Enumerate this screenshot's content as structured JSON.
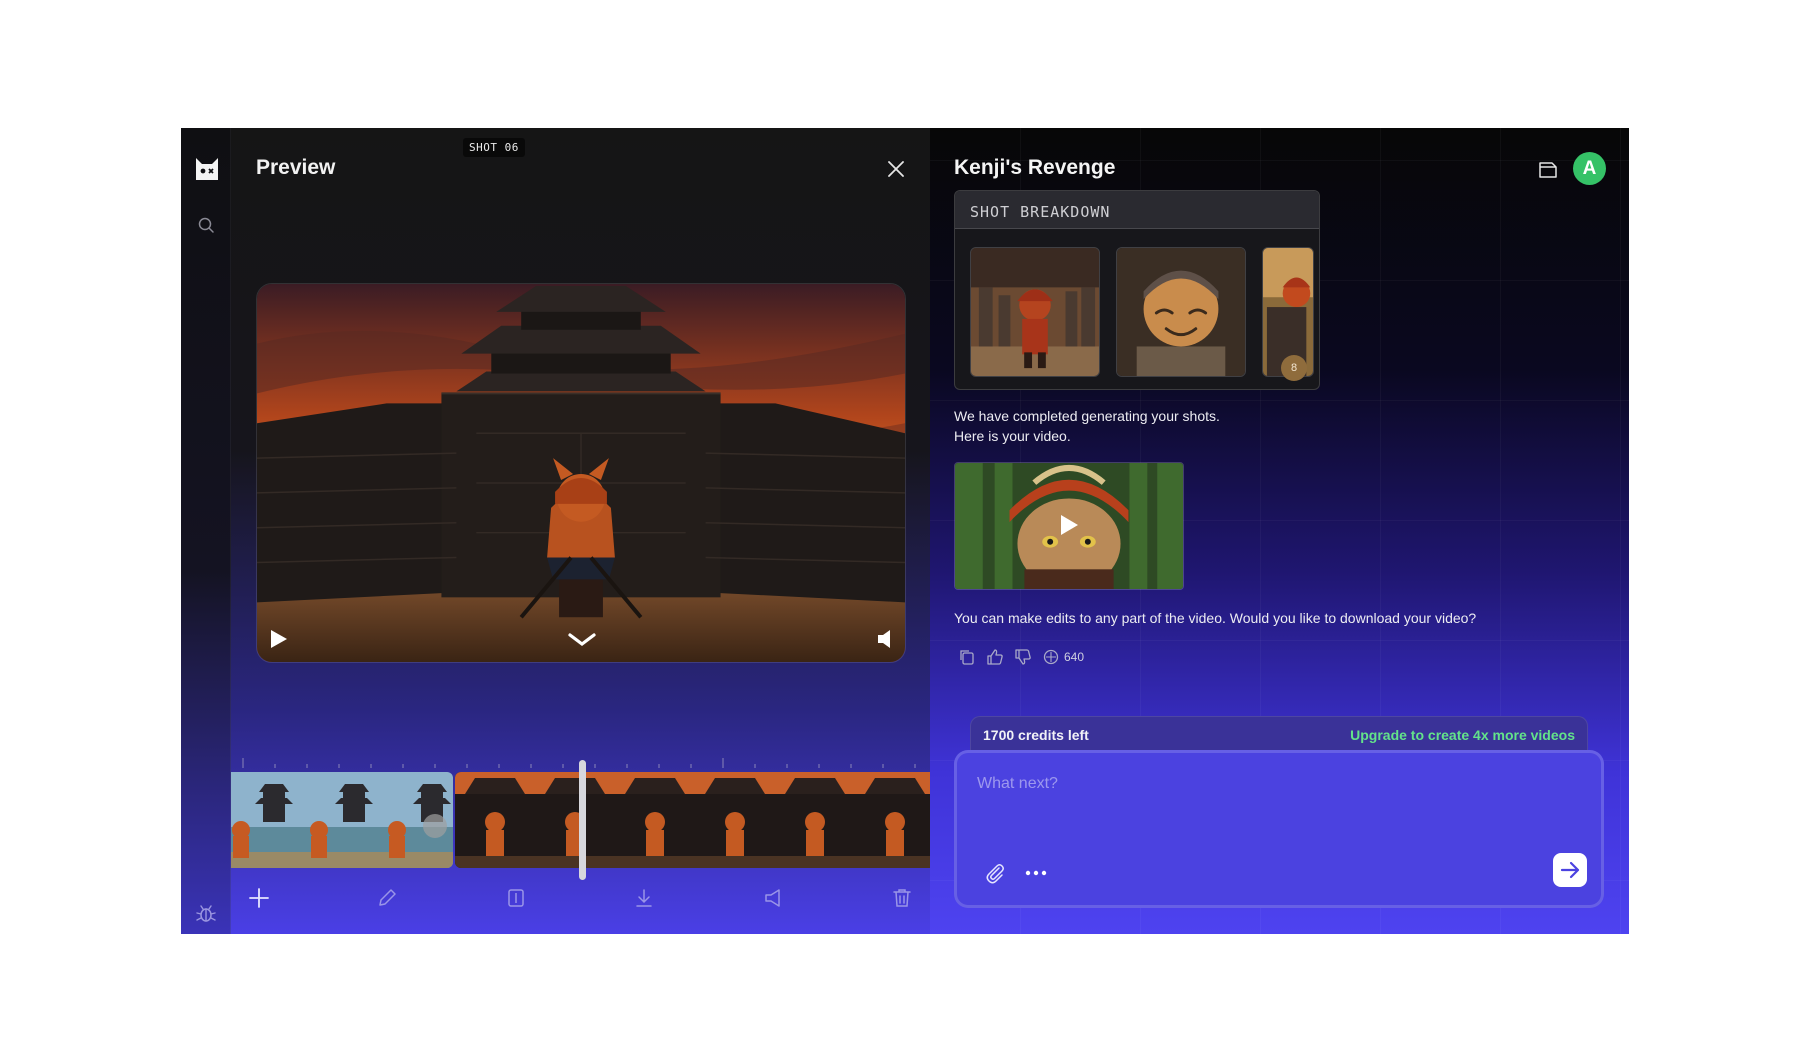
{
  "preview": {
    "title": "Preview",
    "shot_label": "SHOT 06"
  },
  "chat": {
    "title": "Kenji's Revenge",
    "avatar_initial": "A",
    "breakdown_title": "SHOT BREAKDOWN",
    "breakdown_count": "8",
    "message_1_line_1": "We have completed generating your shots.",
    "message_1_line_2": "Here is your video.",
    "message_2": "You can make edits to any part of the video. Would you like to download your video?",
    "token_count": "640",
    "credits_left": "1700 credits left",
    "upgrade_link": "Upgrade to create 4x more videos",
    "input_placeholder": "What next?"
  },
  "colors": {
    "accent": "#4b42e0",
    "upgrade_green": "#63e38a",
    "avatar_green": "#35c267"
  },
  "icons": {
    "rail": [
      "logo-icon",
      "search-icon",
      "bug-icon"
    ],
    "video": [
      "play-icon",
      "chevron-down-icon",
      "volume-icon"
    ],
    "timeline_tools": [
      "plus-icon",
      "pencil-icon",
      "split-icon",
      "download-icon",
      "audio-icon",
      "trash-icon"
    ],
    "message_actions": [
      "copy-icon",
      "thumbs-up-icon",
      "thumbs-down-icon",
      "credits-icon"
    ],
    "composer": [
      "paperclip-icon",
      "more-icon",
      "arrow-right-icon"
    ]
  }
}
